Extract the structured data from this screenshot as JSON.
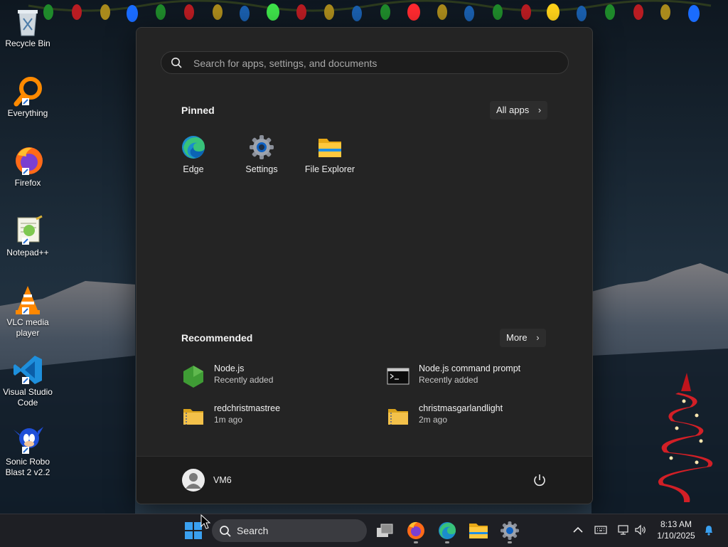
{
  "desktop": {
    "icons": [
      {
        "label": "Recycle Bin",
        "icon": "recycle-bin-icon"
      },
      {
        "label": "Everything",
        "icon": "everything-search-icon"
      },
      {
        "label": "Firefox",
        "icon": "firefox-icon"
      },
      {
        "label": "Notepad++",
        "icon": "notepad-plus-plus-icon"
      },
      {
        "label": "VLC media player",
        "icon": "vlc-cone-icon"
      },
      {
        "label": "Visual Studio Code",
        "icon": "vscode-icon"
      },
      {
        "label": "Sonic Robo Blast 2 v2.2",
        "icon": "sonic-icon"
      }
    ]
  },
  "start_menu": {
    "search": {
      "placeholder": "Search for apps, settings, and documents",
      "value": ""
    },
    "pinned": {
      "title": "Pinned",
      "all_apps_label": "All apps",
      "apps": [
        {
          "label": "Edge",
          "icon": "edge-icon"
        },
        {
          "label": "Settings",
          "icon": "settings-gear-icon"
        },
        {
          "label": "File Explorer",
          "icon": "folder-icon"
        }
      ]
    },
    "recommended": {
      "title": "Recommended",
      "more_label": "More",
      "items": [
        {
          "name": "Node.js",
          "detail": "Recently added",
          "icon": "nodejs-icon"
        },
        {
          "name": "Node.js command prompt",
          "detail": "Recently added",
          "icon": "command-prompt-icon"
        },
        {
          "name": "redchristmastree",
          "detail": "1m ago",
          "icon": "zip-folder-icon"
        },
        {
          "name": "christmasgarlandlight",
          "detail": "2m ago",
          "icon": "zip-folder-icon"
        }
      ]
    },
    "user": {
      "name": "VM6"
    }
  },
  "taskbar": {
    "search_label": "Search",
    "apps": [
      "start-icon",
      "task-view-icon",
      "firefox-icon",
      "edge-icon",
      "file-explorer-icon",
      "settings-gear-icon"
    ],
    "tray": [
      "chevron-up-icon",
      "keyboard-icon",
      "network-icon",
      "volume-icon",
      "notification-bell-icon"
    ],
    "time": "8:13 AM",
    "date": "1/10/2025"
  },
  "colors": {
    "accent": "#0078d4",
    "menu_bg": "#242424",
    "taskbar_bg": "#1e1f24"
  }
}
